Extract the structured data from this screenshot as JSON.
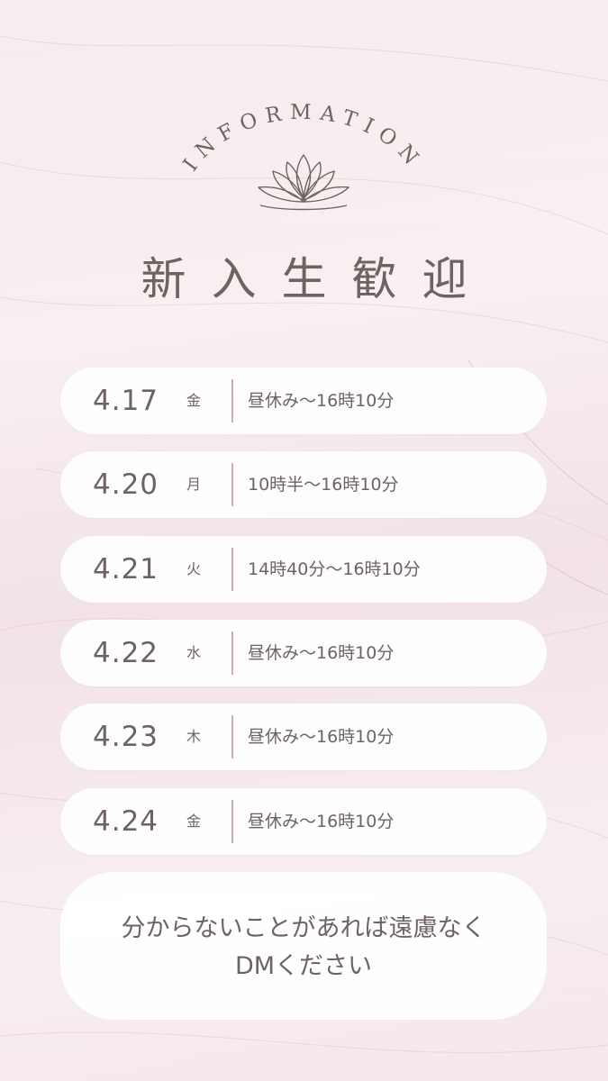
{
  "header": {
    "arc_title": "INFORMATION",
    "title": "新入生歓迎"
  },
  "schedule": [
    {
      "date": "4.17",
      "weekday": "金",
      "time": "昼休み～16時10分"
    },
    {
      "date": "4.20",
      "weekday": "月",
      "time": "10時半～16時10分"
    },
    {
      "date": "4.21",
      "weekday": "火",
      "time": "14時40分～16時10分"
    },
    {
      "date": "4.22",
      "weekday": "水",
      "time": "昼休み～16時10分"
    },
    {
      "date": "4.23",
      "weekday": "木",
      "time": "昼休み～16時10分"
    },
    {
      "date": "4.24",
      "weekday": "金",
      "time": "昼休み～16時10分"
    }
  ],
  "note": {
    "line1": "分からないことがあれば遠慮なく",
    "line2": "DMください"
  },
  "colors": {
    "text": "#6e6362",
    "background": "#f6e9ec",
    "card": "#ffffff",
    "separator": "#c9aeae"
  },
  "icons": {
    "emblem": "lotus-icon"
  }
}
